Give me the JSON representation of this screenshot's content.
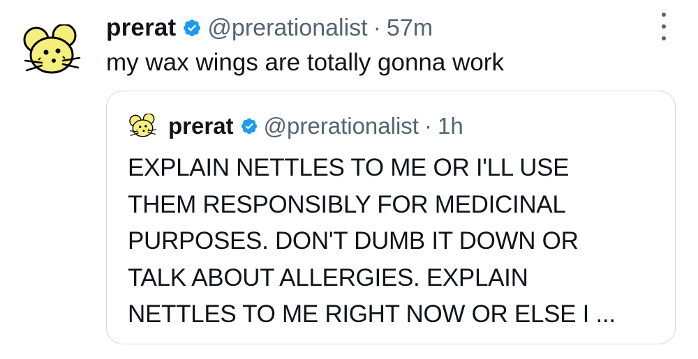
{
  "tweet": {
    "display_name": "prerat",
    "handle": "@prerationalist",
    "separator": "·",
    "timestamp": "57m",
    "text": "my wax wings are totally gonna work",
    "avatar_icon": "mouse-face-icon",
    "verified_icon": "verified-badge-icon",
    "more_icon": "more-vertical-icon"
  },
  "quote": {
    "display_name": "prerat",
    "handle": "@prerationalist",
    "separator": "·",
    "timestamp": "1h",
    "lines": [
      "EXPLAIN NETTLES TO ME OR I'LL USE",
      "THEM RESPONSIBLY FOR MEDICINAL",
      "PURPOSES. DON'T DUMB IT DOWN OR",
      "TALK ABOUT ALLERGIES. EXPLAIN",
      "NETTLES TO ME RIGHT NOW OR ELSE I ..."
    ]
  },
  "colors": {
    "text": "#0f1419",
    "secondary": "#536471",
    "verified": "#1d9bf0",
    "avatar_fill": "#f5ef7e",
    "border": "#cfd9de"
  }
}
